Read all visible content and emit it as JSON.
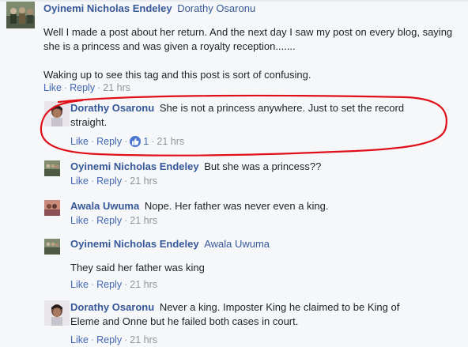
{
  "actions": {
    "like": "Like",
    "reply": "Reply",
    "separator": "·"
  },
  "comments": [
    {
      "author": "Oyinemi Nicholas Endeley",
      "tag": "Dorathy Osaronu",
      "paragraphs": [
        "Well I made a post about her return. And the next day I saw my post on every blog, saying she is a princess and was given a royalty reception.......",
        "Waking up to see this tag and this post is sort of confusing."
      ],
      "time": "21 hrs"
    },
    {
      "author": "Dorathy Osaronu",
      "text": "She is not a princess anywhere. Just to set the record straight.",
      "like_count": "1",
      "time": "21 hrs"
    },
    {
      "author": "Oyinemi Nicholas Endeley",
      "text": "But she was a princess??",
      "time": "21 hrs"
    },
    {
      "author": "Awala Uwuma",
      "text": "Nope. Her father was never even a king.",
      "time": "21 hrs"
    },
    {
      "author": "Oyinemi Nicholas Endeley",
      "tag": "Awala Uwuma",
      "text": "They said her father was king",
      "time": "21 hrs"
    },
    {
      "author": "Dorathy Osaronu",
      "text": "Never a king. Imposter King he claimed to be King of Eleme and Onne but he failed both cases in court.",
      "time": "21 hrs"
    }
  ],
  "colors": {
    "link": "#365899",
    "action": "#4267b2",
    "muted": "#90949c",
    "highlight_oval": "#e0101a",
    "like_badge": "#4a76d1"
  }
}
